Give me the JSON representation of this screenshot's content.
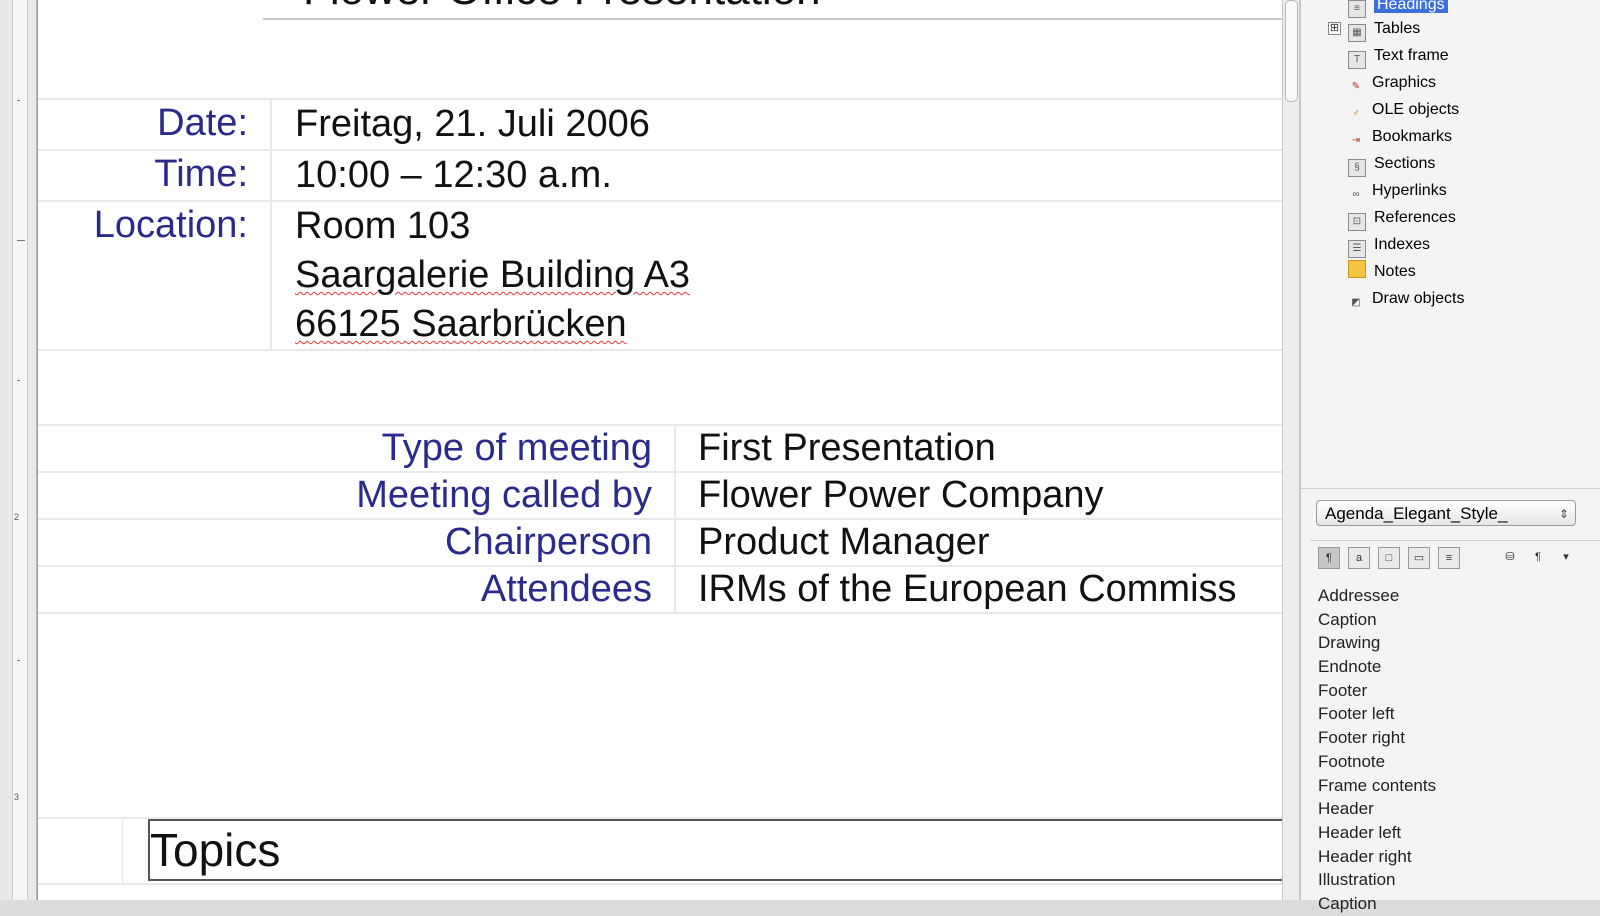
{
  "document": {
    "title": "Flower Office Presentation",
    "meta": [
      {
        "label": "Date:",
        "lines": [
          "Freitag, 21. Juli 2006"
        ]
      },
      {
        "label": "Time:",
        "lines": [
          "10:00 – 12:30 a.m."
        ]
      },
      {
        "label": "Location:",
        "lines": [
          "Room 103",
          "Saargalerie Building A3",
          "66125 Saarbrücken"
        ]
      }
    ],
    "info": [
      {
        "label": "Type of meeting",
        "value": "First Presentation"
      },
      {
        "label": "Meeting called by",
        "value": "Flower Power Company"
      },
      {
        "label": "Chairperson",
        "value": "Product Manager"
      },
      {
        "label": "Attendees",
        "value": "IRMs of the European Commiss"
      }
    ],
    "topics_heading": "Topics"
  },
  "ruler": {
    "numbers": [
      "2",
      "3"
    ]
  },
  "navigator": {
    "items": [
      {
        "label": "Headings",
        "icon": "headings-icon",
        "selected": true
      },
      {
        "label": "Tables",
        "icon": "tables-icon",
        "expander": "⊞"
      },
      {
        "label": "Text frame",
        "icon": "text-frame-icon"
      },
      {
        "label": "Graphics",
        "icon": "graphics-icon"
      },
      {
        "label": "OLE objects",
        "icon": "ole-objects-icon"
      },
      {
        "label": "Bookmarks",
        "icon": "bookmarks-icon"
      },
      {
        "label": "Sections",
        "icon": "sections-icon"
      },
      {
        "label": "Hyperlinks",
        "icon": "hyperlinks-icon"
      },
      {
        "label": "References",
        "icon": "references-icon"
      },
      {
        "label": "Indexes",
        "icon": "indexes-icon"
      },
      {
        "label": "Notes",
        "icon": "notes-icon"
      },
      {
        "label": "Draw objects",
        "icon": "draw-objects-icon"
      }
    ]
  },
  "styles": {
    "selected_document": "Agenda_Elegant_Style_",
    "toolbar_icons": [
      "paragraph-styles-icon",
      "character-styles-icon",
      "frame-styles-icon",
      "page-styles-icon",
      "list-styles-icon",
      "fill-format-icon",
      "new-style-icon",
      "dropdown-arrow-icon"
    ],
    "list": [
      "Addressee",
      "Caption",
      "Drawing",
      "Endnote",
      "Footer",
      "Footer left",
      "Footer right",
      "Footnote",
      "Frame contents",
      "Header",
      "Header left",
      "Header right",
      "Illustration",
      "Caption"
    ]
  },
  "colors": {
    "label_blue": "#2a2a8c",
    "selection": "#3d6fd8",
    "spellcheck": "#e03a3a"
  }
}
